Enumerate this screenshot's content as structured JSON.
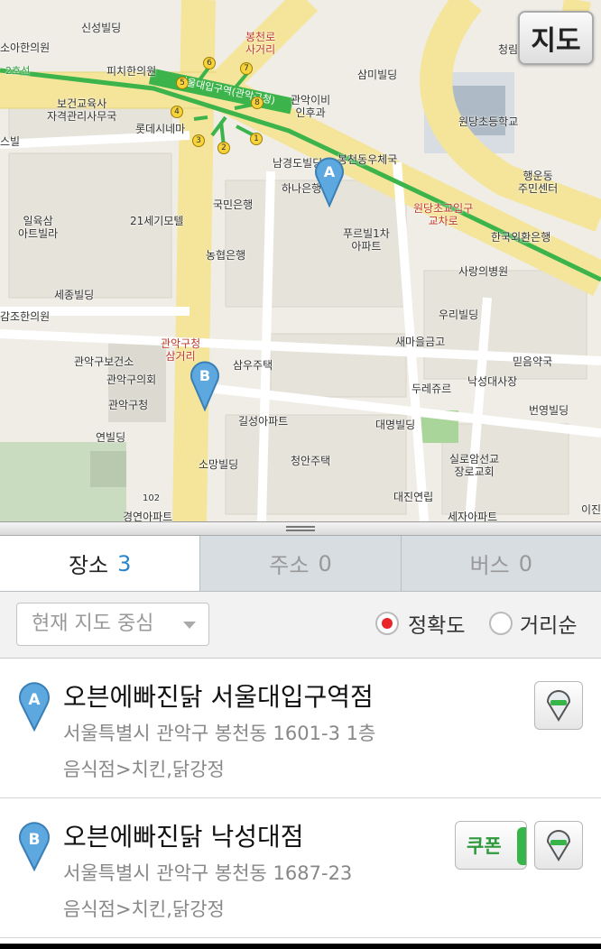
{
  "map": {
    "toggle_label": "지도",
    "pin_a_label": "A",
    "pin_b_label": "B",
    "subway_line": "서울대입구역(관악구청)",
    "exits": [
      "1",
      "2",
      "3",
      "4",
      "5",
      "6",
      "7",
      "8"
    ],
    "labels": {
      "sinseong": "신성빌딩",
      "soaheen": "소아한의원",
      "line2": "2호선",
      "pichi": "피치한의원",
      "bongcheon": "봉천로\n사거리",
      "cheongnim": "청림빌라",
      "sammi": "삼미빌딩",
      "bogeon": "보건교육사\n자격관리사무국",
      "lotte": "롯데시네마",
      "gwanak_ebi": "관악이비\n인후과",
      "wondang_school": "원당초등학교",
      "seubil": "스빌",
      "namgyeong": "남경도빌딩",
      "bongcheon_post": "봉천동우체국",
      "haengun": "행운동\n주민센터",
      "hana": "하나은행",
      "wondang_cross": "원당초교입구\n교차로",
      "kookmin": "국민은행",
      "ilyuksam": "일육삼\n아트빌라",
      "century21": "21세기모텔",
      "pureubil": "푸르빌1차\n아파트",
      "hanguk_exchange": "한국외환은행",
      "nonghyup": "농협은행",
      "sarang": "사랑의병원",
      "sejong": "세종빌딩",
      "gamjo": "감조한의원",
      "uri": "우리빌딩",
      "saemaeul": "새마을금고",
      "gwanak_cross": "관악구청\n삼거리",
      "mideum": "믿음약국",
      "gwanak_health": "관악구보건소",
      "samu": "삼우주택",
      "duresure": "두레쥬르",
      "nakseong_temple": "낙성대사장",
      "gwanak_council": "관악구의회",
      "gwanak_office": "관악구청",
      "beonyeong": "번영빌딩",
      "gilseong": "길성아파트",
      "daemyeong": "대명빌딩",
      "yeon": "연빌딩",
      "silloam": "실로암선교\n장로교회",
      "somang": "소망빌딩",
      "cheongan": "청안주택",
      "daejin": "대진연립",
      "ijin": "이진",
      "seja": "세자아파트",
      "gyeongyeon": "경연아파트",
      "apt102": "102"
    }
  },
  "tabs": [
    {
      "label": "장소",
      "count": "3"
    },
    {
      "label": "주소",
      "count": "0"
    },
    {
      "label": "버스",
      "count": "0"
    }
  ],
  "filters": {
    "dropdown": "현재 지도 중심",
    "radio_accuracy": "정확도",
    "radio_distance": "거리순"
  },
  "results": [
    {
      "marker": "A",
      "name": "오븐에빠진닭 서울대입구역점",
      "address": "서울특별시 관악구 봉천동 1601-3 1층",
      "category": "음식점>치킨,닭강정"
    },
    {
      "marker": "B",
      "name": "오븐에빠진닭 낙성대점",
      "address": "서울특별시 관악구 봉천동 1687-23",
      "category": "음식점>치킨,닭강정",
      "coupon": "쿠폰"
    }
  ],
  "colors": {
    "road_major": "#f4e59a",
    "subway": "#3cb44b",
    "pin": "#5ea8e0",
    "accent": "#2a86c9",
    "radio_on": "#e8262a"
  }
}
